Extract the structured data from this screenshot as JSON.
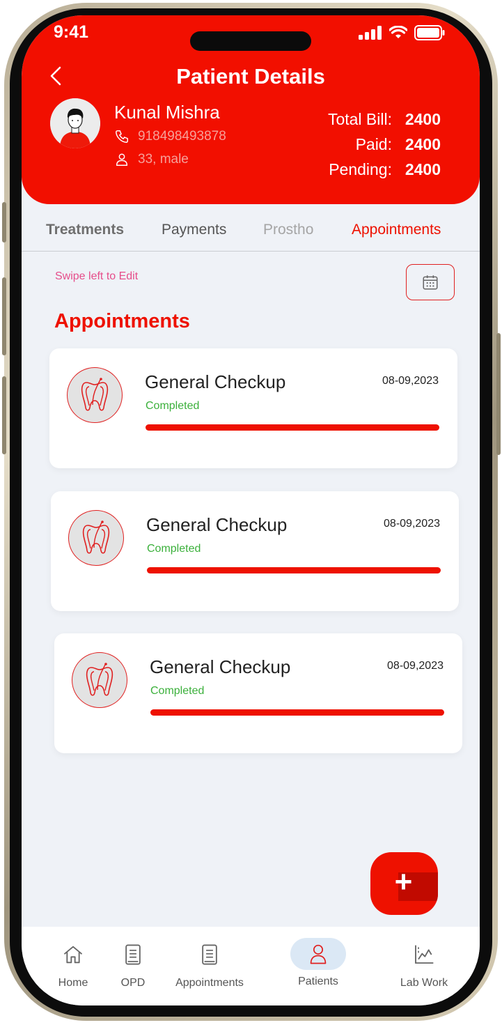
{
  "status_bar": {
    "time": "9:41"
  },
  "header": {
    "title": "Patient Details",
    "patient": {
      "name": "Kunal Mishra",
      "phone": "918498493878",
      "age_gender": "33, male"
    },
    "billing": {
      "total_label": "Total Bill:",
      "total_value": "2400",
      "paid_label": "Paid:",
      "paid_value": "2400",
      "pending_label": "Pending:",
      "pending_value": "2400"
    }
  },
  "tabs": [
    {
      "label": "Treatments",
      "state": "default"
    },
    {
      "label": "Payments",
      "state": "default"
    },
    {
      "label": "Prostho",
      "state": "muted"
    },
    {
      "label": "Appointments",
      "state": "active"
    }
  ],
  "hint": "Swipe left to Edit",
  "section_title": "Appointments",
  "appointments": [
    {
      "title": "General Checkup",
      "date": "08-09,2023",
      "status": "Completed",
      "progress": 1.0
    },
    {
      "title": "General Checkup",
      "date": "08-09,2023",
      "status": "Completed",
      "progress": 1.0
    },
    {
      "title": "General Checkup",
      "date": "08-09,2023",
      "status": "Completed",
      "progress": 1.0
    }
  ],
  "fab": {
    "icon": "plus-icon"
  },
  "bottom_nav": [
    {
      "label": "Home",
      "icon": "home-icon"
    },
    {
      "label": "OPD",
      "icon": "opd-icon"
    },
    {
      "label": "Appointments",
      "icon": "appointments-icon"
    },
    {
      "label": "Patients",
      "icon": "patients-icon",
      "active": true
    },
    {
      "label": "Lab Work",
      "icon": "lab-work-icon"
    }
  ],
  "colors": {
    "primary": "#f20f00",
    "success": "#3bb03b",
    "background": "#eff2f7",
    "active_nav": "#dbe8f5"
  }
}
